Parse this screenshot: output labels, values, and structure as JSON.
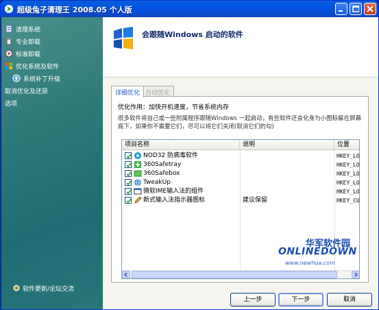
{
  "window": {
    "title": "超级兔子清理王  2008.05 个人版"
  },
  "sidebar": {
    "items": [
      {
        "label": "清理系统",
        "icon": "broom-icon",
        "sub": false
      },
      {
        "label": "专业卸载",
        "icon": "trash-icon",
        "sub": false
      },
      {
        "label": "标准卸载",
        "icon": "disc-icon",
        "sub": false
      },
      {
        "label": "优化系统及软件",
        "icon": "windows-flag-icon",
        "sub": false
      },
      {
        "label": "系统补丁升级",
        "icon": "patch-icon",
        "sub": true
      },
      {
        "label": "取消优化及还原",
        "icon": "",
        "sub": false
      },
      {
        "label": "选项",
        "icon": "",
        "sub": false
      }
    ],
    "footer": "软件更新/论坛交流"
  },
  "header": {
    "title": "会跟随Windows 启动的软件"
  },
  "tabs": [
    {
      "label": "详细优化",
      "active": true
    },
    {
      "label": "自动优化",
      "active": false
    }
  ],
  "panel": {
    "note": "优化作用：加快开机速度，节省系统内存",
    "description": "很多软件将自己或一些附属程序跟随Windows 一起启动，有些软件还会化身为小图标躲在屏幕底下，如果你不需要它们，尽可以将它们关闭(取消它们的勾)"
  },
  "table": {
    "columns": [
      "项目名称",
      "说明",
      "位置"
    ],
    "rows": [
      {
        "name": "NOD32 防病毒软件",
        "desc": "",
        "location": "HKEY_LO",
        "checked": true,
        "icon": "nod32-icon"
      },
      {
        "name": "360Safetray",
        "desc": "",
        "location": "HKEY_LO",
        "checked": true,
        "icon": "green-plus-icon"
      },
      {
        "name": "360Safebox",
        "desc": "",
        "location": "HKEY_LO",
        "checked": true,
        "icon": "green-box-icon"
      },
      {
        "name": "TweakUp",
        "desc": "",
        "location": "HKEY_LO",
        "checked": true,
        "icon": "globe-icon"
      },
      {
        "name": "微软IME输入法的组件",
        "desc": "",
        "location": "HKEY_LO",
        "checked": true,
        "icon": "window-icon"
      },
      {
        "name": "新式输入法指示器图标",
        "desc": "建议保留",
        "location": "HKEY_CU",
        "checked": true,
        "icon": "pen-icon"
      }
    ]
  },
  "watermark": {
    "cn": "华军软件园",
    "en": "ONLINEDOWN",
    "url": "www.newhua.com"
  },
  "buttons": {
    "prev": "上一步",
    "next": "下一步",
    "cancel": "取消"
  },
  "colors": {
    "titlebar": "#0054e3",
    "sidebar": "#2f7a7a",
    "header_title": "#102a6b",
    "active_tab": "#1f5fbf"
  }
}
